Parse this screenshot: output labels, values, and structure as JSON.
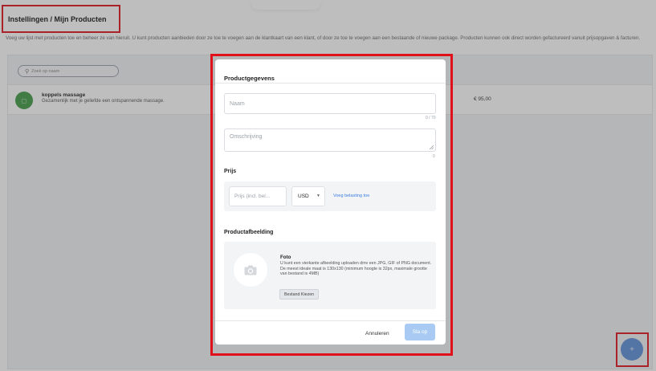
{
  "page": {
    "title": "Instellingen / Mijn Producten",
    "intro": "Voeg uw lijst met producten toe en beheer ze van hieruit. U kunt producten aanbieden door ze toe te voegen aan de klantkaart van een klant, of door ze toe te voegen aan een bestaande of nieuwe package. Producten kunnen ook direct worden gefactureerd vanuit prijsopgaven & facturen."
  },
  "search": {
    "placeholder": "Zoek op naam"
  },
  "products": [
    {
      "name": "koppels massage",
      "description": "Gezamenlijk met je geliefde een ontspannende massage.",
      "price": "€ 95,00"
    }
  ],
  "fab": {
    "label": "+"
  },
  "modal": {
    "title": "Productgegevens",
    "name_placeholder": "Naam",
    "name_counter": "0 / 70",
    "description_placeholder": "Omschrijving",
    "description_counter": "0",
    "price_section": "Prijs",
    "price_placeholder": "Prijs (incl. bel...",
    "currency": "USD",
    "add_tax_link": "Voeg belasting toe",
    "image_section": "Productafbeelding",
    "photo_title": "Foto",
    "photo_description": "U kunt een vierkante afbeelding uploaden dmv een JPG, GIF of PNG document. De meest ideale maat is 130x130 (minimum hoogte is 32px, maximale grootte van bestand is 4MB)",
    "choose_file": "Bestand Kiezen",
    "cancel": "Annuleren",
    "save": "Sla op"
  },
  "colors": {
    "accent_blue": "#3b7de0",
    "save_button": "#a9cbf3",
    "fab": "#5b8fd9",
    "highlight_red": "#e0111a",
    "avatar_green": "#3f9a45"
  },
  "icons": {
    "search": "search-icon",
    "product": "product-icon",
    "camera": "camera-icon",
    "dropdown": "chevron-down-icon"
  }
}
